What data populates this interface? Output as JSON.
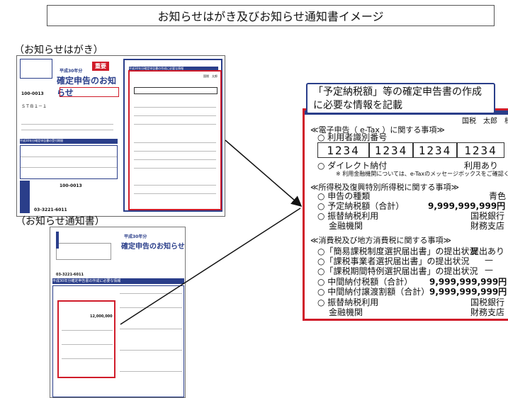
{
  "title": "お知らせはがき及びお知らせ通知書イメージ",
  "labels": {
    "postcard": "（お知らせはがき）",
    "notice": "（お知らせ通知書）"
  },
  "callout": {
    "line1": "「予定納税額」等の確定申告書の作成",
    "line2": "に必要な情報を記載"
  },
  "postcard": {
    "badge": "重要",
    "year": "平成30年分",
    "heading": "確定申告のお知らせ",
    "zip": "100-0013",
    "code": "ＳＴＢ１－１",
    "right_heading": "平成30年分確定申告書の作成に必要な情報",
    "zip2": "100-0013",
    "phone": "03-3221-6011",
    "left_section": "平成30年分確定申告書の受付期間",
    "corner_name": "国税　太郎"
  },
  "notice": {
    "year": "平成30年分",
    "heading": "確定申告のお知らせ",
    "bar": "平成30年分確定申告書の作成に必要な情報",
    "phone": "03-3221-6011",
    "amount": "12,000,000"
  },
  "zoom": {
    "name": "国税　太郎　様",
    "sec_etax": "≪電子申告（ e-Tax ）に関する事項≫",
    "user_id_label": "○ 利用者識別番号",
    "id_parts": [
      "1234",
      "1234",
      "1234",
      "1234"
    ],
    "direct_label": "○ ダイレクト納付",
    "direct_value": "利用あり",
    "direct_note": "※ 利用金融機関については、e-Taxのメッセージボックスをご確認ください。",
    "sec_income": "≪所得税及復興特別所得税に関する事項≫",
    "kind_label": "○ 申告の種類",
    "kind_value": "青色",
    "prepay_label": "○ 予定納税額（合計）",
    "prepay_value": "9,999,999,999円",
    "transfer_label": "○ 振替納税利用",
    "transfer_value": "国税銀行",
    "bank_label": "金融機関",
    "bank_value": "財務支店",
    "sec_consumption": "≪消費税及び地方消費税に関する事項≫",
    "simple_label": "○「簡易課税制度選択届出書」の提出状況",
    "simple_value": "提出あり",
    "taxable_label": "○「課税事業者選択届出書」の提出状況",
    "taxable_value": "—",
    "period_label": "○「課税期間特例選択届出書」の提出状況",
    "period_value": "—",
    "interim_label": "○ 中間納付税額（合計）",
    "interim_value": "9,999,999,999円",
    "interim_local_label": "○ 中間納付譲渡割額（合計）",
    "interim_local_value": "9,999,999,999円",
    "transfer2_label": "○ 振替納税利用",
    "transfer2_value": "国税銀行",
    "bank2_label": "金融機関",
    "bank2_value": "財務支店"
  },
  "colors": {
    "accent_red": "#d01c2a",
    "accent_blue": "#2a3e8a"
  }
}
